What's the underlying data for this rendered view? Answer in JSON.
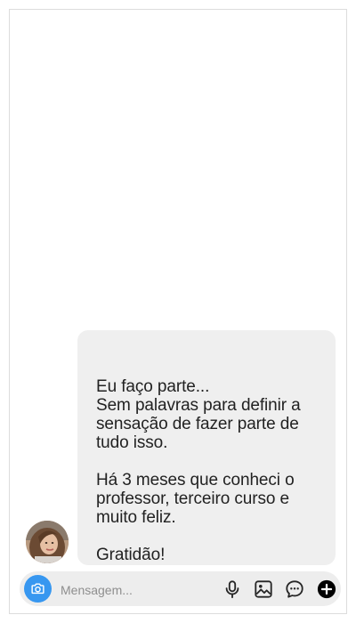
{
  "thread": {
    "message": {
      "text": "Eu faço parte...\nSem palavras para definir a sensação de fazer parte de tudo isso.\n\nHá 3 meses que conheci o professor, terceiro curso e muito feliz.\n\nGratidão!"
    }
  },
  "composer": {
    "placeholder": "Mensagem...",
    "icons": [
      "camera-icon",
      "microphone-icon",
      "gallery-icon",
      "sticker-icon",
      "add-icon"
    ]
  },
  "colors": {
    "accent": "#3797f0",
    "bubble": "#efefef",
    "composer": "#ededed"
  }
}
